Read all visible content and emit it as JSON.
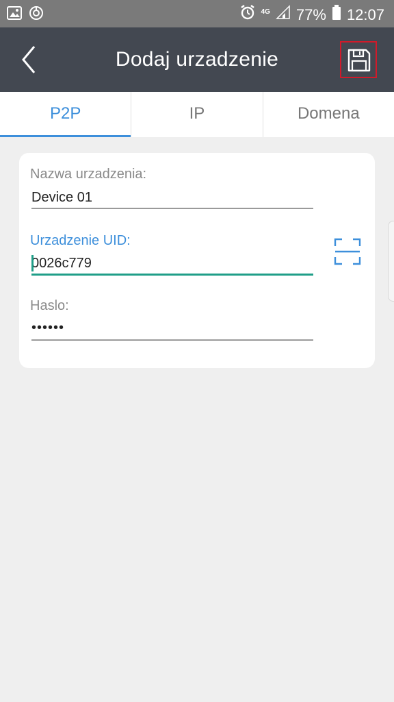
{
  "status_bar": {
    "network": "4G",
    "battery": "77%",
    "time": "12:07"
  },
  "header": {
    "title": "Dodaj urzadzenie"
  },
  "tabs": [
    {
      "label": "P2P",
      "active": true
    },
    {
      "label": "IP",
      "active": false
    },
    {
      "label": "Domena",
      "active": false
    }
  ],
  "form": {
    "device_name": {
      "label": "Nazwa urzadzenia:",
      "value": "Device 01"
    },
    "device_uid": {
      "label": "Urzadzenie UID:",
      "value": "0026c779"
    },
    "password": {
      "label": "Haslo:",
      "value": "••••••"
    }
  },
  "colors": {
    "accent": "#3d8fdb",
    "focus_underline": "#1f9e88",
    "header_bg": "#434851",
    "status_bg": "#7a7a7a",
    "save_highlight": "#d11a2a"
  }
}
